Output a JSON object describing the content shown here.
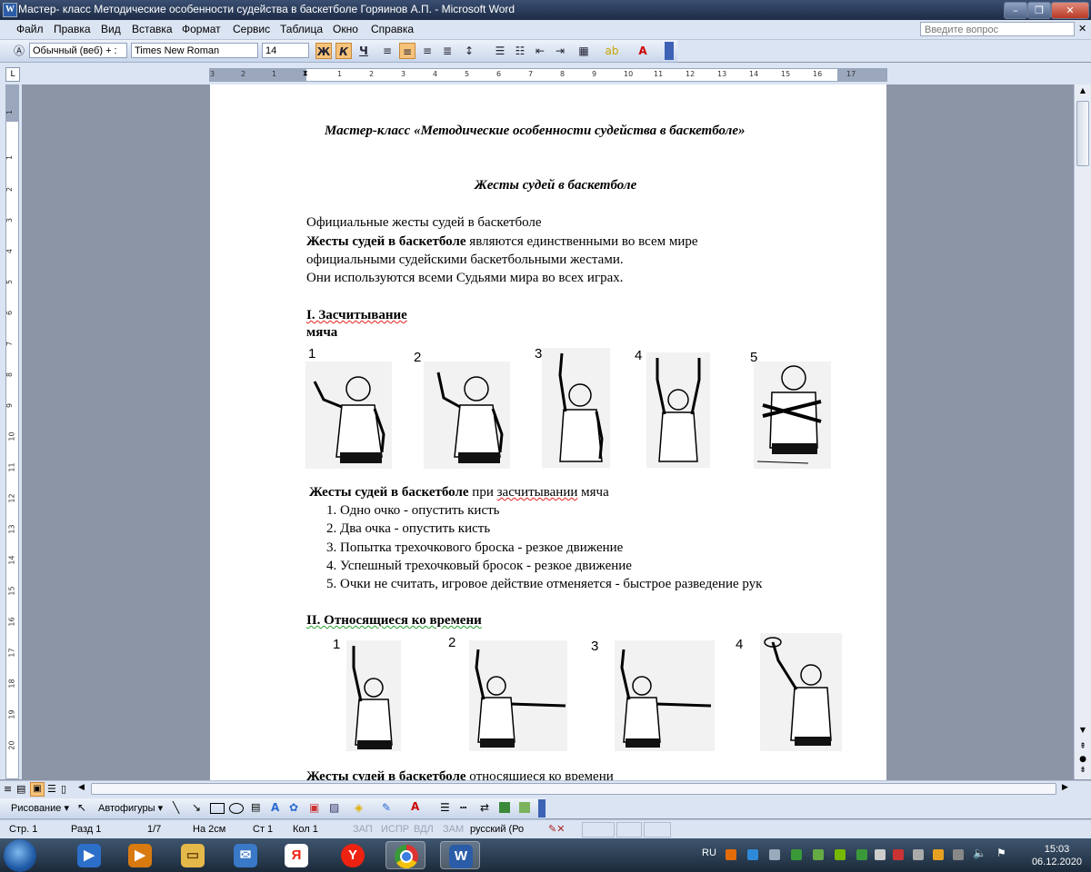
{
  "window": {
    "title": "Мастер- класс Методические особенности судейства в баскетболе Горяинов А.П. - Microsoft Word",
    "app_icon": "word-doc-icon"
  },
  "menu": {
    "items": [
      "Файл",
      "Правка",
      "Вид",
      "Вставка",
      "Формат",
      "Сервис",
      "Таблица",
      "Окно",
      "Справка"
    ],
    "ask_placeholder": "Введите вопрос"
  },
  "format_toolbar": {
    "style": "Обычный (веб) + :",
    "font": "Times New Roman",
    "size": "14",
    "bold": "Ж",
    "italic": "К",
    "underline": "Ч",
    "active": [
      "bold",
      "italic",
      "align-center"
    ]
  },
  "ruler": {
    "numbers": [
      "3",
      "2",
      "1",
      "1",
      "2",
      "3",
      "4",
      "5",
      "6",
      "7",
      "8",
      "9",
      "10",
      "11",
      "12",
      "13",
      "14",
      "15",
      "16",
      "17"
    ],
    "vnumbers": [
      "1",
      "1",
      "2",
      "3",
      "4",
      "5",
      "6",
      "7",
      "8",
      "9",
      "10",
      "11",
      "12",
      "13",
      "14",
      "15",
      "16",
      "17",
      "18",
      "19",
      "20"
    ]
  },
  "document": {
    "heading": "Мастер-класс «Методические особенности судейства в баскетболе»",
    "subheading": "Жесты судей в баскетболе",
    "intro_line1": "Официальные жесты судей в баскетболе",
    "intro_bold": "Жесты судей в баскетболе",
    "intro_line2_rest": " являются единственными во всем мире",
    "intro_line3": "официальными судейскими баскетбольными жестами.",
    "intro_line4": "Они используются всеми Судьями мира во всех играх.",
    "section1_title_a": "I. Засчитывание",
    "section1_title_b": "мяча",
    "section1_figure_numbers": [
      "1",
      "2",
      "3",
      "4",
      "5"
    ],
    "section1_caption_bold": "Жесты судей в баскетболе",
    "section1_caption_rest_a": " при ",
    "section1_caption_rest_b": "засчитывании",
    "section1_caption_rest_c": " мяча",
    "section1_list": [
      "Одно очко - опустить кисть",
      "Два очка - опустить кисть",
      "Попытка трехочкового броска - резкое движение",
      "Успешный трехочковый бросок - резкое движение",
      "Очки не считать, игровое действие отменяется - быстрое разведение рук"
    ],
    "section2_title": "II. Относящиеся ко времени",
    "section2_figure_numbers": [
      "1",
      "2",
      "3",
      "4"
    ],
    "section2_caption_bold": "Жесты судей в баскетболе",
    "section2_caption_rest": " относящиеся ко времени"
  },
  "draw_toolbar": {
    "draw": "Рисование",
    "autoshapes": "Автофигуры"
  },
  "status": {
    "page": "Стр. 1",
    "section": "Разд 1",
    "pages": "1/7",
    "at": "На 2см",
    "line": "Ст 1",
    "col": "Кол 1",
    "rec": "ЗАП",
    "trk": "ИСПР",
    "ext": "ВДЛ",
    "ovr": "ЗАМ",
    "language": "русский (Ро"
  },
  "taskbar": {
    "language": "RU",
    "time": "15:03",
    "date": "06.12.2020",
    "apps": [
      "start-orb-icon",
      "media-player-icon",
      "media-center-icon",
      "explorer-folder-icon",
      "mail-icon",
      "yandex-icon",
      "yandex-browser-icon",
      "chrome-icon",
      "word-icon"
    ]
  }
}
